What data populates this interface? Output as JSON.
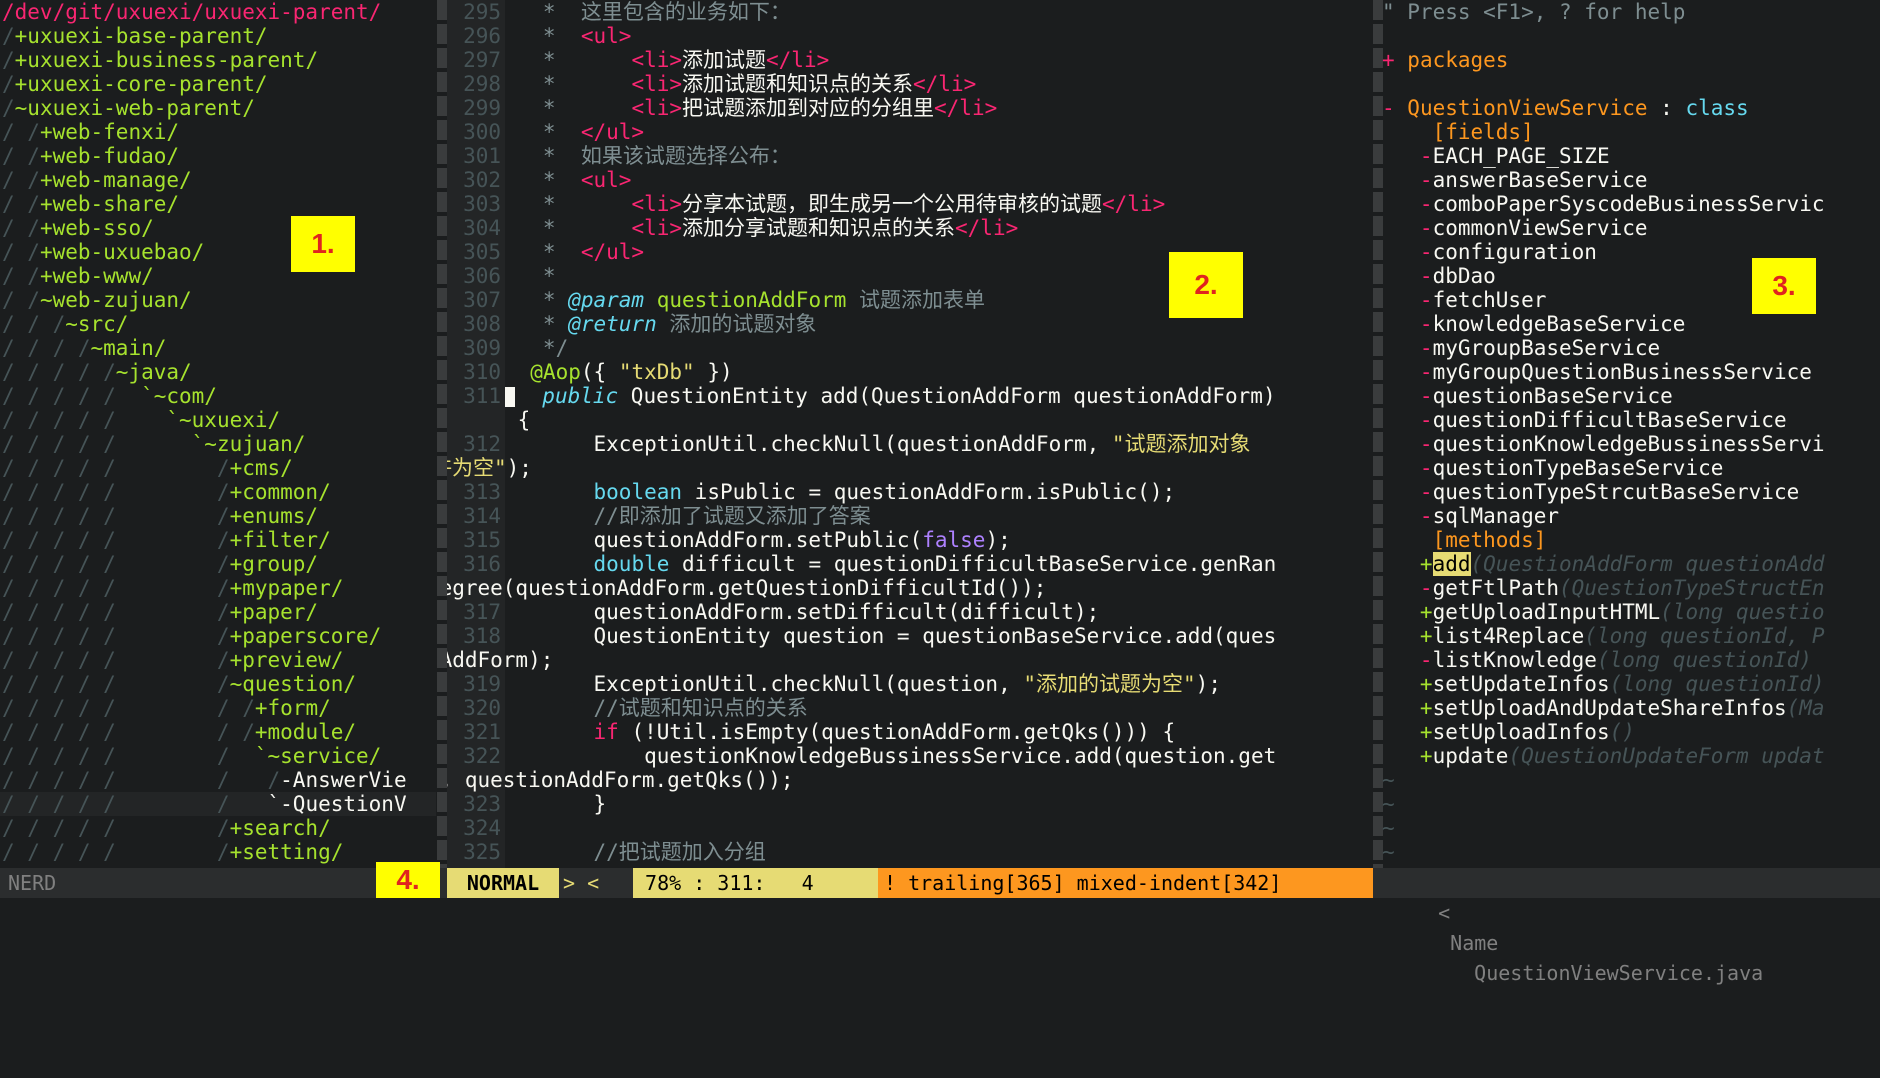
{
  "tree": {
    "lines": [
      {
        "prefix": "",
        "name": "/dev/git/uxuexi/uxuexi-parent/",
        "kind": "root"
      },
      {
        "prefix": "/",
        "name": "+uxuexi-base-parent/",
        "kind": "dir"
      },
      {
        "prefix": "/",
        "name": "+uxuexi-business-parent/",
        "kind": "dir"
      },
      {
        "prefix": "/",
        "name": "+uxuexi-core-parent/",
        "kind": "dir"
      },
      {
        "prefix": "/",
        "name": "~uxuexi-web-parent/",
        "kind": "dir"
      },
      {
        "prefix": "/ /",
        "name": "+web-fenxi/",
        "kind": "dir"
      },
      {
        "prefix": "/ /",
        "name": "+web-fudao/",
        "kind": "dir"
      },
      {
        "prefix": "/ /",
        "name": "+web-manage/",
        "kind": "dir"
      },
      {
        "prefix": "/ /",
        "name": "+web-share/",
        "kind": "dir"
      },
      {
        "prefix": "/ /",
        "name": "+web-sso/",
        "kind": "dir"
      },
      {
        "prefix": "/ /",
        "name": "+web-uxuebao/",
        "kind": "dir"
      },
      {
        "prefix": "/ /",
        "name": "+web-www/",
        "kind": "dir"
      },
      {
        "prefix": "/ /",
        "name": "~web-zujuan/",
        "kind": "dir"
      },
      {
        "prefix": "/ / /",
        "name": "~src/",
        "kind": "dir"
      },
      {
        "prefix": "/ / / /",
        "name": "~main/",
        "kind": "dir"
      },
      {
        "prefix": "/ / / / /",
        "name": "~java/",
        "kind": "dir"
      },
      {
        "prefix": "/ / / / /  ",
        "name": "`~com/",
        "kind": "dir"
      },
      {
        "prefix": "/ / / / /    ",
        "name": "`~uxuexi/",
        "kind": "dir"
      },
      {
        "prefix": "/ / / / /      ",
        "name": "`~zujuan/",
        "kind": "dir"
      },
      {
        "prefix": "/ / / / /        /",
        "name": "+cms/",
        "kind": "dir"
      },
      {
        "prefix": "/ / / / /        /",
        "name": "+common/",
        "kind": "dir"
      },
      {
        "prefix": "/ / / / /        /",
        "name": "+enums/",
        "kind": "dir"
      },
      {
        "prefix": "/ / / / /        /",
        "name": "+filter/",
        "kind": "dir"
      },
      {
        "prefix": "/ / / / /        /",
        "name": "+group/",
        "kind": "dir"
      },
      {
        "prefix": "/ / / / /        /",
        "name": "+mypaper/",
        "kind": "dir"
      },
      {
        "prefix": "/ / / / /        /",
        "name": "+paper/",
        "kind": "dir"
      },
      {
        "prefix": "/ / / / /        /",
        "name": "+paperscore/",
        "kind": "dir"
      },
      {
        "prefix": "/ / / / /        /",
        "name": "+preview/",
        "kind": "dir"
      },
      {
        "prefix": "/ / / / /        /",
        "name": "~question/",
        "kind": "dir"
      },
      {
        "prefix": "/ / / / /        / /",
        "name": "+form/",
        "kind": "dir"
      },
      {
        "prefix": "/ / / / /        / /",
        "name": "+module/",
        "kind": "dir"
      },
      {
        "prefix": "/ / / / /        /  ",
        "name": "`~service/",
        "kind": "dir"
      },
      {
        "prefix": "/ / / / /        /   /",
        "name": "-AnswerVie",
        "kind": "file"
      },
      {
        "prefix": "/ / / / /        /   ",
        "name": "`-QuestionV",
        "kind": "file",
        "current": true
      },
      {
        "prefix": "/ / / / /        /",
        "name": "+search/",
        "kind": "dir"
      },
      {
        "prefix": "/ / / / /        /",
        "name": "+setting/",
        "kind": "dir"
      }
    ]
  },
  "code": {
    "lines": [
      {
        "n": "295",
        "t": [
          [
            "   *  ",
            "cmt"
          ],
          [
            "这里包含的业务如下：",
            "cmt"
          ]
        ]
      },
      {
        "n": "296",
        "t": [
          [
            "   *  ",
            "cmt"
          ],
          [
            "<ul>",
            "tagh"
          ]
        ]
      },
      {
        "n": "297",
        "t": [
          [
            "   *      ",
            "cmt"
          ],
          [
            "<li>",
            "tagh"
          ],
          [
            "添加试题",
            "cw"
          ],
          [
            "</li>",
            "tagh"
          ]
        ]
      },
      {
        "n": "298",
        "t": [
          [
            "   *      ",
            "cmt"
          ],
          [
            "<li>",
            "tagh"
          ],
          [
            "添加试题和知识点的关系",
            "cw"
          ],
          [
            "</li>",
            "tagh"
          ]
        ]
      },
      {
        "n": "299",
        "t": [
          [
            "   *      ",
            "cmt"
          ],
          [
            "<li>",
            "tagh"
          ],
          [
            "把试题添加到对应的分组里",
            "cw"
          ],
          [
            "</li>",
            "tagh"
          ]
        ]
      },
      {
        "n": "300",
        "t": [
          [
            "   *  ",
            "cmt"
          ],
          [
            "</ul>",
            "tagh"
          ]
        ]
      },
      {
        "n": "301",
        "t": [
          [
            "   *  ",
            "cmt"
          ],
          [
            "如果该试题选择公布：",
            "cmt"
          ]
        ]
      },
      {
        "n": "302",
        "t": [
          [
            "   *  ",
            "cmt"
          ],
          [
            "<ul>",
            "tagh"
          ]
        ]
      },
      {
        "n": "303",
        "t": [
          [
            "   *      ",
            "cmt"
          ],
          [
            "<li>",
            "tagh"
          ],
          [
            "分享本试题，即生成另一个公用待审核的试题",
            "cw"
          ],
          [
            "</li>",
            "tagh"
          ]
        ]
      },
      {
        "n": "304",
        "t": [
          [
            "   *      ",
            "cmt"
          ],
          [
            "<li>",
            "tagh"
          ],
          [
            "添加分享试题和知识点的关系",
            "cw"
          ],
          [
            "</li>",
            "tagh"
          ]
        ]
      },
      {
        "n": "305",
        "t": [
          [
            "   *  ",
            "cmt"
          ],
          [
            "</ul>",
            "tagh"
          ]
        ]
      },
      {
        "n": "306",
        "t": [
          [
            "   *",
            "cmt"
          ]
        ]
      },
      {
        "n": "307",
        "t": [
          [
            "   * ",
            "cmt"
          ],
          [
            "@param",
            "doc"
          ],
          [
            " questionAddForm ",
            "ann"
          ],
          [
            "试题添加表单",
            "cmt"
          ]
        ]
      },
      {
        "n": "308",
        "t": [
          [
            "   * ",
            "cmt"
          ],
          [
            "@return",
            "doc"
          ],
          [
            " 添加的试题对象",
            "cmt"
          ]
        ]
      },
      {
        "n": "309",
        "t": [
          [
            "   */",
            "cmt"
          ]
        ]
      },
      {
        "n": "310",
        "t": [
          [
            "  ",
            "cw"
          ],
          [
            "@Aop",
            "ann"
          ],
          [
            "({ ",
            "cw"
          ],
          [
            "\"txDb\"",
            "str"
          ],
          [
            " })",
            "cw"
          ]
        ]
      },
      {
        "n": "311",
        "t": [
          [
            "  ",
            "cw"
          ],
          [
            "public",
            "doc"
          ],
          [
            " QuestionEntity add(QuestionAddForm questionAddForm)",
            "cw"
          ]
        ],
        "cursor": true
      },
      {
        "n": "",
        "t": [
          [
            " {",
            "cw"
          ]
        ]
      },
      {
        "n": "312",
        "t": [
          [
            "       ExceptionUtil.checkNull(questionAddForm, ",
            "cw"
          ],
          [
            "\"试题添加对象",
            "str"
          ]
        ]
      },
      {
        "n": "",
        "t": [
          [
            "不允许为空\"",
            "str"
          ],
          [
            ");",
            "cw"
          ]
        ],
        "wrap": true
      },
      {
        "n": "313",
        "t": [
          [
            "       ",
            "cw"
          ],
          [
            "boolean",
            "ty"
          ],
          [
            " isPublic = questionAddForm.isPublic();",
            "cw"
          ]
        ]
      },
      {
        "n": "314",
        "t": [
          [
            "       //即添加了试题又添加了答案",
            "cmt"
          ]
        ]
      },
      {
        "n": "315",
        "t": [
          [
            "       questionAddForm.setPublic(",
            "cw"
          ],
          [
            "false",
            "num"
          ],
          [
            ");",
            "cw"
          ]
        ]
      },
      {
        "n": "316",
        "t": [
          [
            "       ",
            "cw"
          ],
          [
            "double",
            "ty"
          ],
          [
            " difficult = questionDifficultBaseService.genRan",
            "cw"
          ]
        ]
      },
      {
        "n": "",
        "t": [
          [
            "domGegree(questionAddForm.getQuestionDifficultId());",
            "cw"
          ]
        ],
        "wrap": true
      },
      {
        "n": "317",
        "t": [
          [
            "       questionAddForm.setDifficult(difficult);",
            "cw"
          ]
        ]
      },
      {
        "n": "318",
        "t": [
          [
            "       QuestionEntity question = questionBaseService.add(ques",
            "cw"
          ]
        ]
      },
      {
        "n": "",
        "t": [
          [
            "tionAddForm);",
            "cw"
          ]
        ],
        "wrap": true
      },
      {
        "n": "319",
        "t": [
          [
            "       ExceptionUtil.checkNull(question, ",
            "cw"
          ],
          [
            "\"添加的试题为空\"",
            "str"
          ],
          [
            ");",
            "cw"
          ]
        ]
      },
      {
        "n": "320",
        "t": [
          [
            "       //试题和知识点的关系",
            "cmt"
          ]
        ]
      },
      {
        "n": "321",
        "t": [
          [
            "       ",
            "cw"
          ],
          [
            "if",
            "kw"
          ],
          [
            " (!Util.isEmpty(questionAddForm.getQks())) {",
            "cw"
          ]
        ]
      },
      {
        "n": "322",
        "t": [
          [
            "           questionKnowledgeBussinessService.add(question.get",
            "cw"
          ]
        ]
      },
      {
        "n": "",
        "t": [
          [
            "Id(), questionAddForm.getQks());",
            "cw"
          ]
        ],
        "wrap": true
      },
      {
        "n": "323",
        "t": [
          [
            "       }",
            "cw"
          ]
        ]
      },
      {
        "n": "324",
        "t": [
          [
            "",
            "cw"
          ]
        ]
      },
      {
        "n": "325",
        "t": [
          [
            "       //把试题加入分组",
            "cmt"
          ]
        ]
      }
    ]
  },
  "tagbar": {
    "lines": [
      {
        "t": [
          [
            "\" Press <F1>, ? for help",
            "cmt"
          ]
        ]
      },
      {
        "t": [
          [
            "",
            "cw"
          ]
        ]
      },
      {
        "t": [
          [
            "+ ",
            "minus"
          ],
          [
            "packages",
            "sect"
          ]
        ]
      },
      {
        "t": [
          [
            "",
            "cw"
          ]
        ]
      },
      {
        "t": [
          [
            "- ",
            "minus"
          ],
          [
            "QuestionViewService",
            "sect"
          ],
          [
            " : ",
            "cw"
          ],
          [
            "class",
            "ty"
          ]
        ]
      },
      {
        "t": [
          [
            "    [fields]",
            "sect"
          ]
        ]
      },
      {
        "t": [
          [
            "   -",
            "minus"
          ],
          [
            "EACH_PAGE_SIZE",
            "cw"
          ]
        ]
      },
      {
        "t": [
          [
            "   -",
            "minus"
          ],
          [
            "answerBaseService",
            "cw"
          ]
        ]
      },
      {
        "t": [
          [
            "   -",
            "minus"
          ],
          [
            "comboPaperSyscodeBusinessServic",
            "cw"
          ]
        ]
      },
      {
        "t": [
          [
            "   -",
            "minus"
          ],
          [
            "commonViewService",
            "cw"
          ]
        ]
      },
      {
        "t": [
          [
            "   -",
            "minus"
          ],
          [
            "configuration",
            "cw"
          ]
        ]
      },
      {
        "t": [
          [
            "   -",
            "minus"
          ],
          [
            "dbDao",
            "cw"
          ]
        ]
      },
      {
        "t": [
          [
            "   -",
            "minus"
          ],
          [
            "fetchUser",
            "cw"
          ]
        ]
      },
      {
        "t": [
          [
            "   -",
            "minus"
          ],
          [
            "knowledgeBaseService",
            "cw"
          ]
        ]
      },
      {
        "t": [
          [
            "   -",
            "minus"
          ],
          [
            "myGroupBaseService",
            "cw"
          ]
        ]
      },
      {
        "t": [
          [
            "   -",
            "minus"
          ],
          [
            "myGroupQuestionBusinessService",
            "cw"
          ]
        ]
      },
      {
        "t": [
          [
            "   -",
            "minus"
          ],
          [
            "questionBaseService",
            "cw"
          ]
        ]
      },
      {
        "t": [
          [
            "   -",
            "minus"
          ],
          [
            "questionDifficultBaseService",
            "cw"
          ]
        ]
      },
      {
        "t": [
          [
            "   -",
            "minus"
          ],
          [
            "questionKnowledgeBussinessServi",
            "cw"
          ]
        ]
      },
      {
        "t": [
          [
            "   -",
            "minus"
          ],
          [
            "questionTypeBaseService",
            "cw"
          ]
        ]
      },
      {
        "t": [
          [
            "   -",
            "minus"
          ],
          [
            "questionTypeStrcutBaseService",
            "cw"
          ]
        ]
      },
      {
        "t": [
          [
            "   -",
            "minus"
          ],
          [
            "sqlManager",
            "cw"
          ]
        ]
      },
      {
        "t": [
          [
            "    [methods]",
            "sect"
          ]
        ]
      },
      {
        "t": [
          [
            "   +",
            "plus"
          ],
          [
            "add",
            "hl"
          ],
          [
            "(QuestionAddForm questionAdd",
            "sig"
          ]
        ]
      },
      {
        "t": [
          [
            "   -",
            "minus"
          ],
          [
            "getFtlPath",
            "cw"
          ],
          [
            "(QuestionTypeStructEn",
            "sig"
          ]
        ]
      },
      {
        "t": [
          [
            "   +",
            "plus"
          ],
          [
            "getUploadInputHTML",
            "cw"
          ],
          [
            "(long questio",
            "sig"
          ]
        ]
      },
      {
        "t": [
          [
            "   +",
            "plus"
          ],
          [
            "list4Replace",
            "cw"
          ],
          [
            "(long questionId, P",
            "sig"
          ]
        ]
      },
      {
        "t": [
          [
            "   -",
            "minus"
          ],
          [
            "listKnowledge",
            "cw"
          ],
          [
            "(long questionId)",
            "sig"
          ]
        ]
      },
      {
        "t": [
          [
            "   +",
            "plus"
          ],
          [
            "setUpdateInfos",
            "cw"
          ],
          [
            "(long questionId)",
            "sig"
          ]
        ]
      },
      {
        "t": [
          [
            "   +",
            "plus"
          ],
          [
            "setUploadAndUpdateShareInfos",
            "cw"
          ],
          [
            "(Ma",
            "sig"
          ]
        ]
      },
      {
        "t": [
          [
            "   +",
            "plus"
          ],
          [
            "setUploadInfos",
            "cw"
          ],
          [
            "()",
            "sig"
          ]
        ]
      },
      {
        "t": [
          [
            "   +",
            "plus"
          ],
          [
            "update",
            "cw"
          ],
          [
            "(QuestionUpdateForm updat",
            "sig"
          ]
        ]
      },
      {
        "t": [
          [
            "~",
            "tl"
          ]
        ]
      },
      {
        "t": [
          [
            "~",
            "tl"
          ]
        ]
      },
      {
        "t": [
          [
            "~",
            "tl"
          ]
        ]
      },
      {
        "t": [
          [
            "~",
            "tl"
          ]
        ]
      }
    ]
  },
  "status": {
    "left": "NERD",
    "mode": "NORMAL",
    "arrows": "> <",
    "position": " 78% : 311:   4 ",
    "warn": "! trailing[365] mixed-indent[342]",
    "right_arrow": "<",
    "name_label": "Name",
    "file": "QuestionViewService.java"
  },
  "annotations": {
    "a1": "1.",
    "a2": "2.",
    "a3": "3.",
    "a4": "4."
  }
}
